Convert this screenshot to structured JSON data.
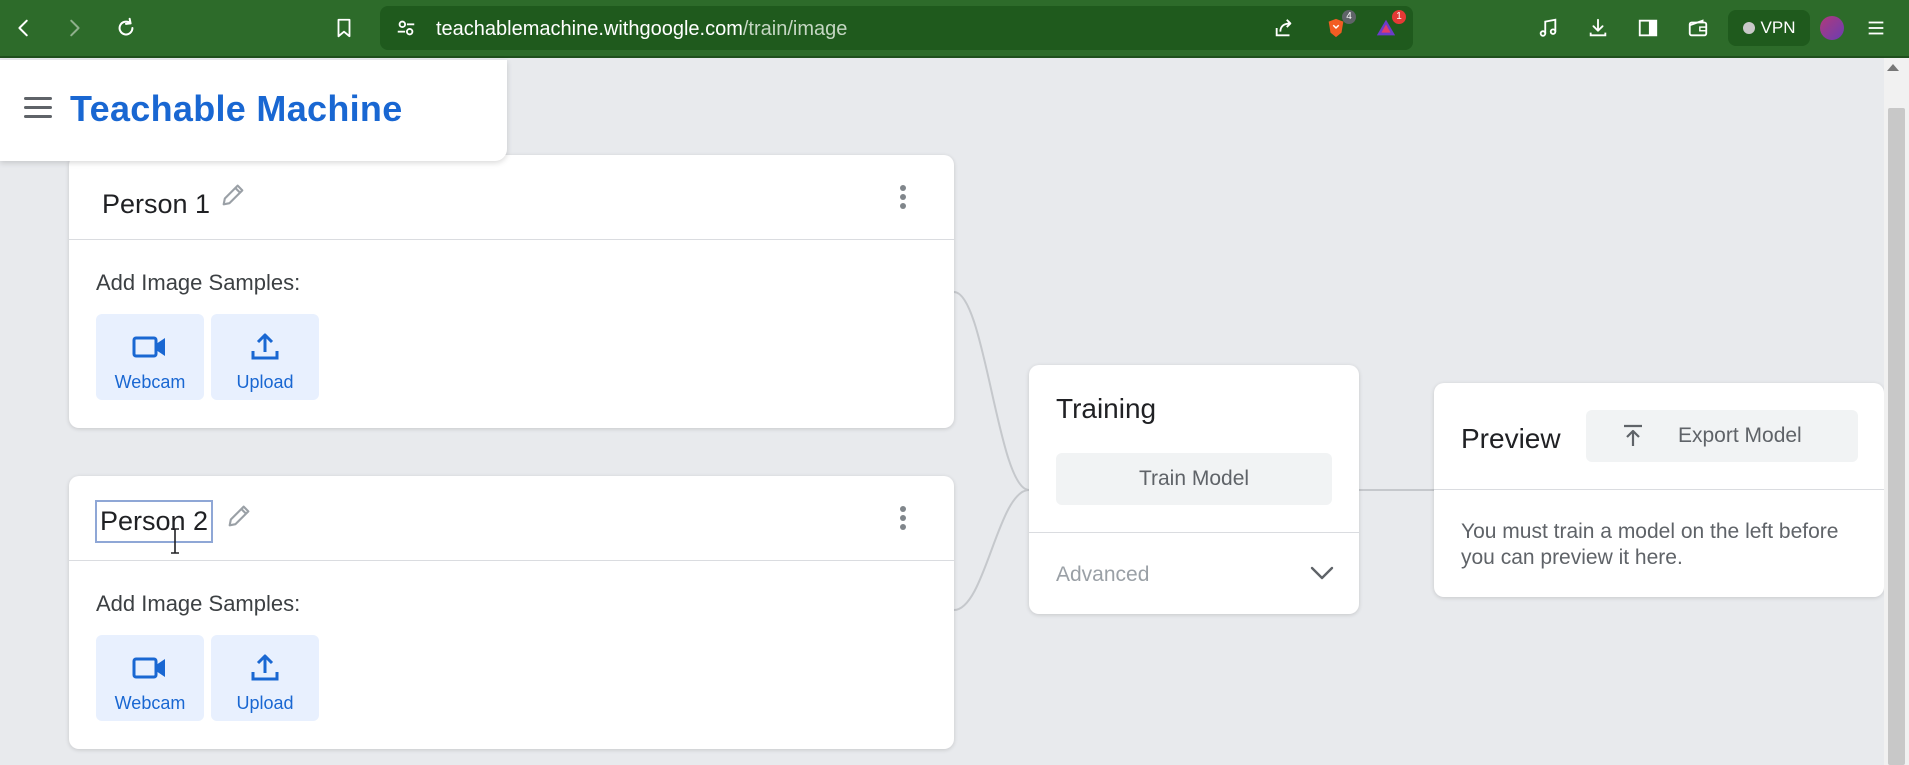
{
  "browser": {
    "url_host": "teachablemachine.withgoogle.com",
    "url_path": "/train/image",
    "brave_badge": "4",
    "rewards_badge": "1",
    "vpn_label": "VPN"
  },
  "app": {
    "title": "Teachable Machine"
  },
  "classes": [
    {
      "name": "Person 1",
      "samples_label": "Add Image Samples:",
      "webcam_label": "Webcam",
      "upload_label": "Upload"
    },
    {
      "name": "Person 2",
      "samples_label": "Add Image Samples:",
      "webcam_label": "Webcam",
      "upload_label": "Upload"
    }
  ],
  "training": {
    "title": "Training",
    "train_button": "Train Model",
    "advanced_label": "Advanced"
  },
  "preview": {
    "title": "Preview",
    "export_button": "Export Model",
    "message": "You must train a model on the left before you can preview it here."
  },
  "colors": {
    "accent": "#1967d2",
    "chrome": "#2d6b2a",
    "background": "#e8eaed"
  }
}
